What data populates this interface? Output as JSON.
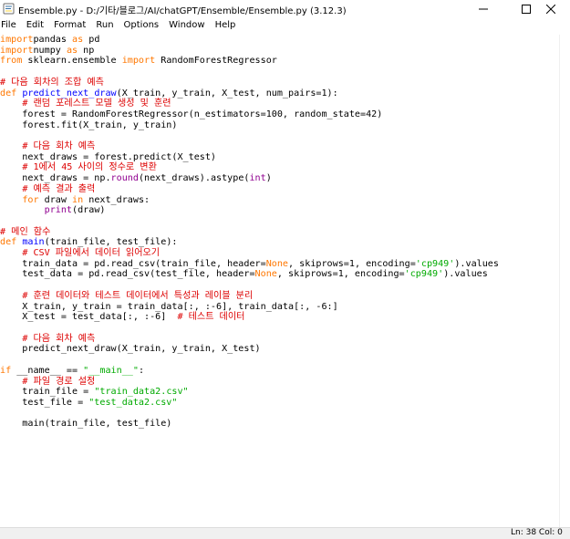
{
  "window": {
    "title": "Ensemble.py - D:/기타/블로그/AI/chatGPT/Ensemble/Ensemble.py (3.12.3)",
    "controls": [
      "minimize",
      "maximize",
      "close"
    ]
  },
  "menu": {
    "items": [
      "File",
      "Edit",
      "Format",
      "Run",
      "Options",
      "Window",
      "Help"
    ]
  },
  "editor": {
    "lines": [
      [
        [
          "kw",
          "import"
        ],
        [
          "",
          "pandas "
        ],
        [
          "kw",
          "as"
        ],
        [
          "",
          " pd"
        ]
      ],
      [
        [
          "kw",
          "import"
        ],
        [
          "",
          "numpy "
        ],
        [
          "kw",
          "as"
        ],
        [
          "",
          " np"
        ]
      ],
      [
        [
          "kw",
          "from"
        ],
        [
          "",
          " sklearn.ensemble "
        ],
        [
          "kw",
          "import"
        ],
        [
          "",
          " RandomForestRegressor"
        ]
      ],
      [],
      [
        [
          "cm",
          "# 다음 회차의 조합 예측"
        ]
      ],
      [
        [
          "kw",
          "def"
        ],
        [
          "",
          " "
        ],
        [
          "def",
          "predict_next_draw"
        ],
        [
          "",
          "(X_train, y_train, X_test, num_pairs=1):"
        ]
      ],
      [
        [
          "",
          "    "
        ],
        [
          "cm",
          "# 랜덤 포레스트 모델 생성 및 훈련"
        ]
      ],
      [
        [
          "",
          "    forest = RandomForestRegressor(n_estimators=100, random_state=42)"
        ]
      ],
      [
        [
          "",
          "    forest.fit(X_train, y_train)"
        ]
      ],
      [],
      [
        [
          "",
          "    "
        ],
        [
          "cm",
          "# 다음 회차 예측"
        ]
      ],
      [
        [
          "",
          "    next_draws = forest.predict(X_test)"
        ]
      ],
      [
        [
          "",
          "    "
        ],
        [
          "cm",
          "# 1에서 45 사이의 정수로 변환"
        ]
      ],
      [
        [
          "",
          "    next_draws = np."
        ],
        [
          "bi",
          "round"
        ],
        [
          "",
          "(next_draws).astype("
        ],
        [
          "bi",
          "int"
        ],
        [
          "",
          ")"
        ]
      ],
      [
        [
          "",
          "    "
        ],
        [
          "cm",
          "# 예측 결과 출력"
        ]
      ],
      [
        [
          "",
          "    "
        ],
        [
          "kw",
          "for"
        ],
        [
          "",
          " draw "
        ],
        [
          "kw",
          "in"
        ],
        [
          "",
          " next_draws:"
        ]
      ],
      [
        [
          "",
          "        "
        ],
        [
          "bi",
          "print"
        ],
        [
          "",
          "(draw)"
        ]
      ],
      [],
      [
        [
          "cm",
          "# 메인 함수"
        ]
      ],
      [
        [
          "kw",
          "def"
        ],
        [
          "",
          " "
        ],
        [
          "def",
          "main"
        ],
        [
          "",
          "(train_file, test_file):"
        ]
      ],
      [
        [
          "",
          "    "
        ],
        [
          "cm",
          "# CSV 파일에서 데이터 읽어오기"
        ]
      ],
      [
        [
          "",
          "    train_data = pd.read_csv(train_file, header="
        ],
        [
          "kw",
          "None"
        ],
        [
          "",
          ", skiprows=1, encoding="
        ],
        [
          "st",
          "'cp949'"
        ],
        [
          "",
          ").values"
        ]
      ],
      [
        [
          "",
          "    test_data = pd.read_csv(test_file, header="
        ],
        [
          "kw",
          "None"
        ],
        [
          "",
          ", skiprows=1, encoding="
        ],
        [
          "st",
          "'cp949'"
        ],
        [
          "",
          ").values"
        ]
      ],
      [],
      [
        [
          "",
          "    "
        ],
        [
          "cm",
          "# 훈련 데이터와 테스트 데이터에서 특성과 레이블 분리"
        ]
      ],
      [
        [
          "",
          "    X_train, y_train = train_data[:, :-6], train_data[:, -6:]"
        ]
      ],
      [
        [
          "",
          "    X_test = test_data[:, :-6]  "
        ],
        [
          "cm",
          "# 테스트 데이터"
        ]
      ],
      [],
      [
        [
          "",
          "    "
        ],
        [
          "cm",
          "# 다음 회차 예측"
        ]
      ],
      [
        [
          "",
          "    predict_next_draw(X_train, y_train, X_test)"
        ]
      ],
      [],
      [
        [
          "kw",
          "if"
        ],
        [
          "",
          " __name__ == "
        ],
        [
          "st",
          "\"__main__\""
        ],
        [
          "",
          ":"
        ]
      ],
      [
        [
          "",
          "    "
        ],
        [
          "cm",
          "# 파일 경로 설정"
        ]
      ],
      [
        [
          "",
          "    train_file = "
        ],
        [
          "st",
          "\"train_data2.csv\""
        ]
      ],
      [
        [
          "",
          "    test_file = "
        ],
        [
          "st",
          "\"test_data2.csv\""
        ]
      ],
      [],
      [
        [
          "",
          "    main(train_file, test_file)"
        ]
      ]
    ]
  },
  "status": {
    "position": "Ln: 38  Col: 0"
  }
}
